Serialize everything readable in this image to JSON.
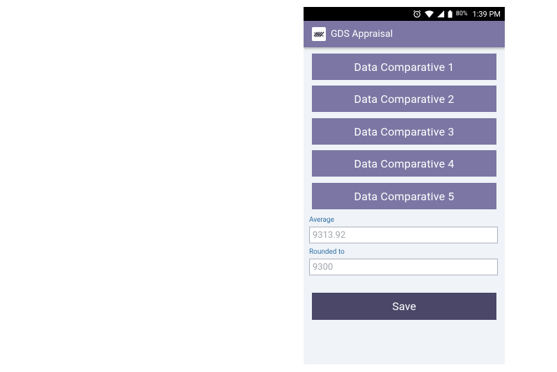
{
  "status_bar": {
    "battery_pct": "80%",
    "time": "1:39 PM"
  },
  "app_bar": {
    "title": "GDS Appraisal",
    "logo_icon": "gds-logo-icon"
  },
  "buttons": [
    {
      "label": "Data Comparative 1"
    },
    {
      "label": "Data Comparative 2"
    },
    {
      "label": "Data Comparative 3"
    },
    {
      "label": "Data Comparative 4"
    },
    {
      "label": "Data Comparative 5"
    }
  ],
  "fields": {
    "average": {
      "label": "Average",
      "value": "9313.92"
    },
    "rounded": {
      "label": "Rounded to",
      "value": "9300"
    }
  },
  "save_label": "Save",
  "colors": {
    "accent": "#7b76a3",
    "save": "#4a4768",
    "label": "#2e6fa8"
  }
}
